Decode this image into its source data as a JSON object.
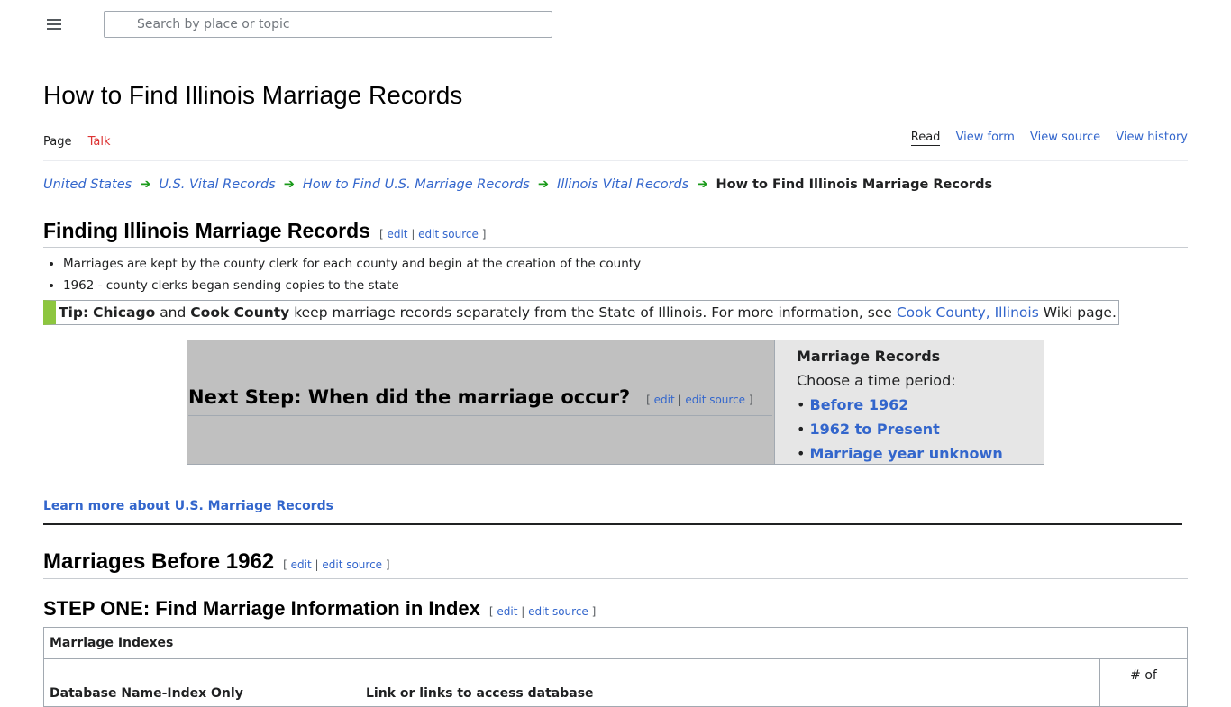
{
  "search": {
    "placeholder": "Search by place or topic"
  },
  "page": {
    "title": "How to Find Illinois Marriage Records"
  },
  "tabs": {
    "left": [
      "Page",
      "Talk"
    ],
    "right": [
      "Read",
      "View form",
      "View source",
      "View history"
    ]
  },
  "breadcrumb": {
    "items": [
      "United States",
      "U.S. Vital Records",
      "How to Find U.S. Marriage Records",
      "Illinois Vital Records"
    ],
    "current": "How to Find Illinois Marriage Records"
  },
  "section_finding": {
    "heading": "Finding Illinois Marriage Records",
    "bullets": [
      "Marriages are kept by the county clerk for each county and begin at the creation of the county",
      "1962 - county clerks began sending copies to the state"
    ]
  },
  "edit_links": {
    "edit": "edit",
    "edit_source": "edit source"
  },
  "tip": {
    "label": "Tip:",
    "chicago": "Chicago",
    "and": "and",
    "cook": "Cook County",
    "text1": "keep marriage records separately from the State of Illinois. For more information, see",
    "link": "Cook County, Illinois",
    "text2": "Wiki page."
  },
  "next_step": {
    "heading": "Next Step: When did the marriage occur?",
    "panel_title": "Marriage Records",
    "prompt": "Choose a time period:",
    "options": [
      "Before 1962",
      "1962 to Present",
      "Marriage year unknown"
    ]
  },
  "learn_more": "Learn more about U.S. Marriage Records",
  "section_before": {
    "heading": "Marriages Before 1962"
  },
  "section_step1": {
    "heading": "STEP ONE: Find Marriage Information in Index"
  },
  "table": {
    "caption": "Marriage Indexes",
    "columns": [
      "Database Name-Index Only",
      "Link or links to access database",
      "# of"
    ]
  },
  "colors": {
    "link": "#3366cc",
    "talk": "#dd3333",
    "arrow": "#1a9a1a",
    "tip_bar": "#8dc63f"
  }
}
